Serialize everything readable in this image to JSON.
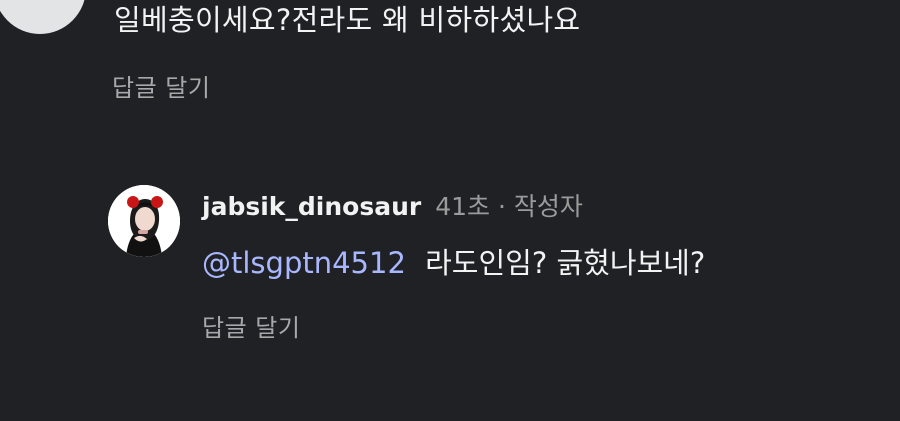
{
  "top_comment": {
    "text": "일베충이세요?전라도 왜 비하하셨나요",
    "reply_label": "답글 달기"
  },
  "reply": {
    "username": "jabsik_dinosaur",
    "meta": "41초 · 작성자",
    "mention": "@tlsgptn4512",
    "text": "라도인임? 긁혔나보네?",
    "reply_label": "답글 달기"
  },
  "icons": {
    "top_avatar": "profile-avatar",
    "reply_avatar": "profile-photo-avatar"
  },
  "colors": {
    "background": "#202125",
    "mention": "#a9b7ff",
    "secondary_text": "#a8a8a8"
  }
}
